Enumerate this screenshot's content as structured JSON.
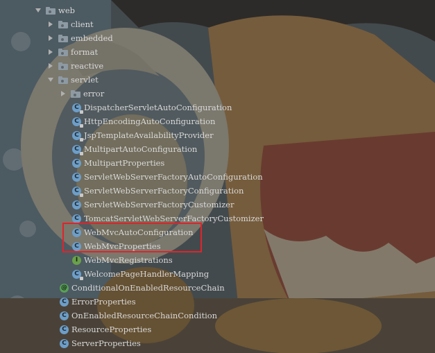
{
  "tree": {
    "web": "web",
    "client": "client",
    "embedded": "embedded",
    "format": "format",
    "reactive": "reactive",
    "servlet": "servlet",
    "error": "error",
    "servlet_classes": [
      "DispatcherServletAutoConfiguration",
      "HttpEncodingAutoConfiguration",
      "JspTemplateAvailabilityProvider",
      "MultipartAutoConfiguration",
      "MultipartProperties",
      "ServletWebServerFactoryAutoConfiguration",
      "ServletWebServerFactoryConfiguration",
      "ServletWebServerFactoryCustomizer",
      "TomcatServletWebServerFactoryCustomizer",
      "WebMvcAutoConfiguration",
      "WebMvcProperties",
      "WebMvcRegistrations",
      "WelcomePageHandlerMapping"
    ],
    "web_items": [
      "ConditionalOnEnabledResourceChain",
      "ErrorProperties",
      "OnEnabledResourceChainCondition",
      "ResourceProperties",
      "ServerProperties"
    ]
  },
  "icons": {
    "class_letter": "C",
    "interface_letter": "I",
    "annotation_letter": "@"
  },
  "colors": {
    "highlight_border": "#e0242a",
    "class_icon": "#6d9ec8",
    "interface_icon": "#6aa04b",
    "folder_icon": "#8e9aa3"
  }
}
